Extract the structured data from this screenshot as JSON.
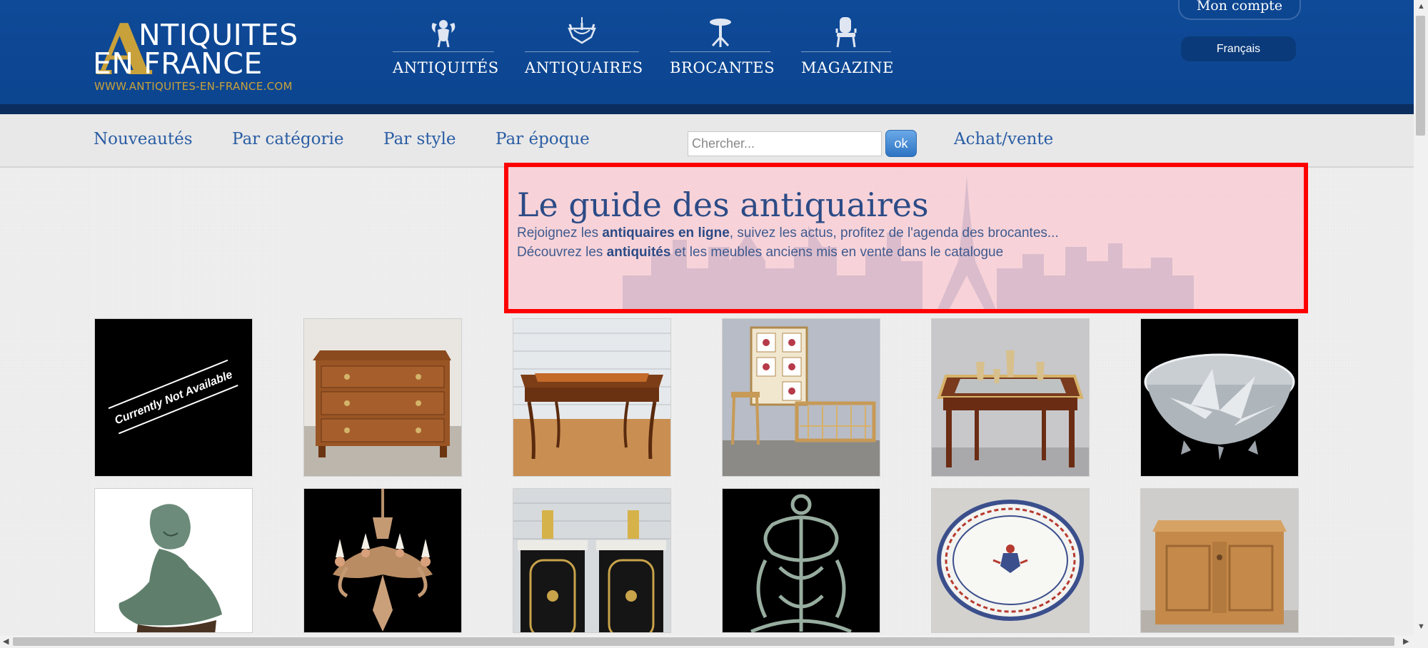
{
  "header": {
    "logo": {
      "letter": "A",
      "line1": "NTIQUITES",
      "line2": "EN FRANCE",
      "url": "WWW.ANTIQUITES-EN-FRANCE.COM"
    },
    "nav": [
      {
        "label": "ANTIQUITÉS",
        "icon": "cherub-icon"
      },
      {
        "label": "ANTIQUAIRES",
        "icon": "chandelier-icon"
      },
      {
        "label": "BROCANTES",
        "icon": "gueridon-table-icon"
      },
      {
        "label": "MAGAZINE",
        "icon": "chair-icon"
      }
    ],
    "account_label": "Mon compte",
    "language": "Français"
  },
  "subnav": {
    "links": [
      "Nouveautés",
      "Par catégorie",
      "Par style",
      "Par époque"
    ],
    "search_placeholder": "Chercher...",
    "search_button": "ok",
    "buy_sell": "Achat/vente"
  },
  "intro": {
    "title": "Le guide des antiquaires",
    "line1_before": "Rejoignez les ",
    "line1_bold": "antiquaires en ligne",
    "line1_after": ", suivez les actus, profitez de l'agenda des brocantes...",
    "line2_before": "Découvrez les ",
    "line2_bold": "antiquités",
    "line2_after": " et les meubles anciens mis en vente dans le catalogue"
  },
  "products": [
    {
      "kind": "placeholder",
      "caption": "Currently Not Available"
    },
    {
      "kind": "commode"
    },
    {
      "kind": "desk"
    },
    {
      "kind": "bamboo-furniture"
    },
    {
      "kind": "tray-table"
    },
    {
      "kind": "glass-bowl"
    },
    {
      "kind": "bust"
    },
    {
      "kind": "chandelier"
    },
    {
      "kind": "cabinet-pair"
    },
    {
      "kind": "cast-iron-rack"
    },
    {
      "kind": "faience-platter"
    },
    {
      "kind": "wooden-chest"
    }
  ],
  "colors": {
    "header_blue": "#0c4590",
    "gold": "#c9a13a",
    "link_blue": "#2a5da4",
    "highlight_border": "#ff0000"
  }
}
